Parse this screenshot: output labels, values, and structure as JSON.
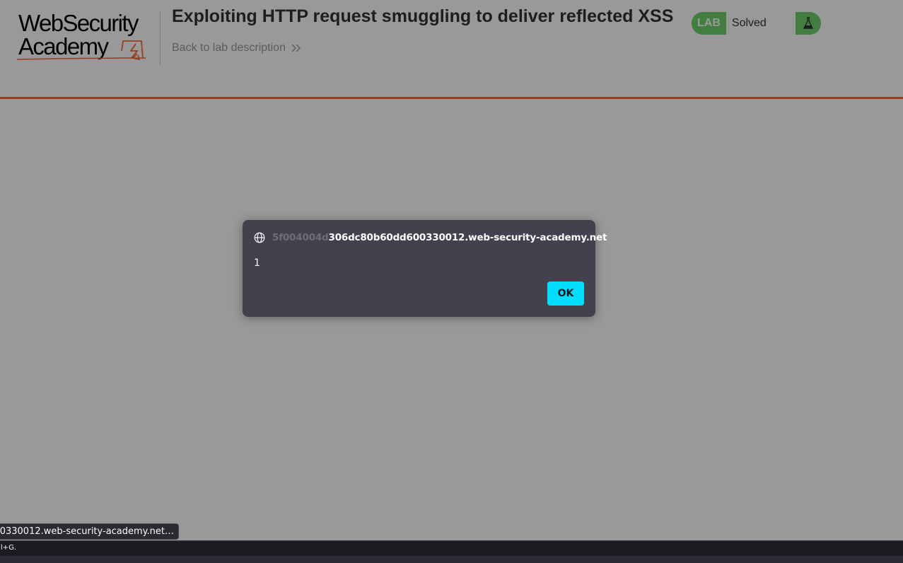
{
  "header": {
    "logo_line1": "WebSecurity",
    "logo_line2": "Academy",
    "lab_title": "Exploiting HTTP request smuggling to deliver reflected XSS",
    "back_link": "Back to lab description",
    "lab_tag": "LAB",
    "lab_status": "Solved",
    "accent_color": "#ff6633",
    "solved_color": "#70d16d"
  },
  "dialog": {
    "origin_faded": "5f004004d",
    "origin_rest": "306dc80b60dd600330012.web-security-academy.net",
    "message": "1",
    "ok_label": "OK",
    "origin_icon": "globe-icon",
    "button_color": "#00ddff"
  },
  "status_bar": {
    "link_preview": "0330012.web-security-academy.net…",
    "hint": "l+G."
  }
}
